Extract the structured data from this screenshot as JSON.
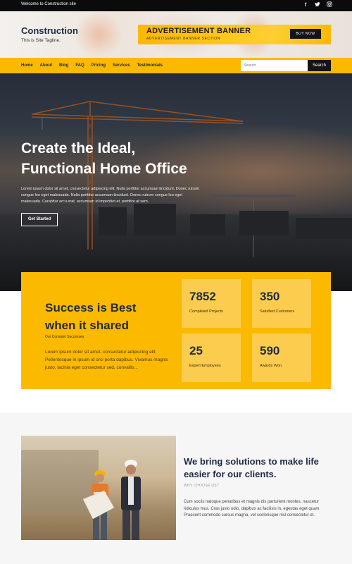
{
  "topbar": {
    "welcome": "Welcome to Construction site",
    "social": [
      {
        "icon": "facebook-icon",
        "glyph": "f"
      },
      {
        "icon": "twitter-icon",
        "glyph": "t"
      },
      {
        "icon": "instagram-icon",
        "glyph": "◎"
      }
    ]
  },
  "header": {
    "site_title": "Construction",
    "tagline": "This is Site Tagline.",
    "ad": {
      "title": "ADVERTISEMENT BANNER",
      "subtitle": "ADVERTISEMENT BANNER SECTION",
      "button": "BUY NOW"
    }
  },
  "nav": {
    "items": [
      "Home",
      "About",
      "Blog",
      "FAQ",
      "Pricing",
      "Services",
      "Testimonials"
    ],
    "search_placeholder": "Search",
    "search_button": "Search"
  },
  "hero": {
    "heading_line1": "Create the Ideal,",
    "heading_line2": "Functional Home Office",
    "text": "Lorem ipsum dolor sit amet, consectetur adipiscing elit. Nulla porttitor accumsan tincidunt. Donec rutrum congue leo eget malesuada. Nulla porttitor accumsan tincidunt. Donec rutrum congue leo eget malesuada. Curabitur arcu erat, accumsan id imperdiet et, porttitor at sem.",
    "cta": "Get Started"
  },
  "stats": {
    "title": "Success is Best when it shared",
    "subtitle": "Our Constant Successes",
    "text": "Lorem ipsum dolor sit amet, consectetur adipiscing elit. Pellentesque in ipsum id orci porta dapibus. Vivamus magna justo, lacinia eget consectetur sed, convallis...",
    "items": [
      {
        "value": "7852",
        "label": "Completed Projects"
      },
      {
        "value": "350",
        "label": "Satisfied Customers"
      },
      {
        "value": "25",
        "label": "Expert Employees"
      },
      {
        "value": "590",
        "label": "Awards Won"
      }
    ]
  },
  "why": {
    "title": "We bring solutions to make life easier for our clients.",
    "subtitle": "WHY CHOOSE US?",
    "text": "Cum sociis natoque penatibus et magnis dis parturient montes, nascetur ridiculus mus. Cras justo odio, dapibus ac facilisis in, egestas eget quam. Praesent commodo cursus magna, vel scelerisque nisl consectetur et."
  },
  "colors": {
    "accent": "#fbb900",
    "dark": "#0b0b0b",
    "navy": "#1f2a44"
  }
}
